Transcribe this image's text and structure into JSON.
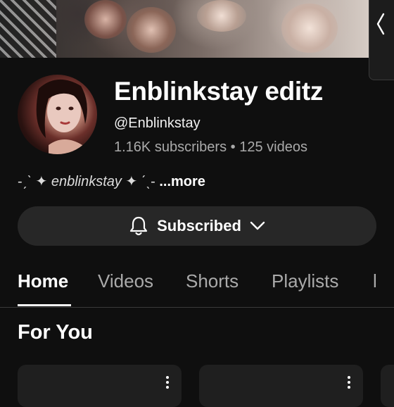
{
  "channel": {
    "name": "Enblinkstay editz",
    "handle": "@Enblinkstay",
    "subscribers": "1.16K subscribers",
    "separator": "•",
    "videos": "125 videos",
    "description_prefix": "-ˏˋ ✦",
    "description_main": "enblinkstay",
    "description_suffix": "✦ ˊˎ-",
    "description_more": "...more"
  },
  "subscribe_button": {
    "label": "Subscribed",
    "icon": "bell-icon",
    "chevron_icon": "chevron-down-icon"
  },
  "tabs": [
    {
      "label": "Home",
      "active": true
    },
    {
      "label": "Videos",
      "active": false
    },
    {
      "label": "Shorts",
      "active": false
    },
    {
      "label": "Playlists",
      "active": false
    },
    {
      "label": "l",
      "active": false
    }
  ],
  "section": {
    "title": "For You"
  },
  "side_panel": {
    "icon": "chevron-left-icon"
  },
  "colors": {
    "background": "#0f0f0f",
    "button_bg": "#272727",
    "secondary_text": "#aaaaaa"
  }
}
